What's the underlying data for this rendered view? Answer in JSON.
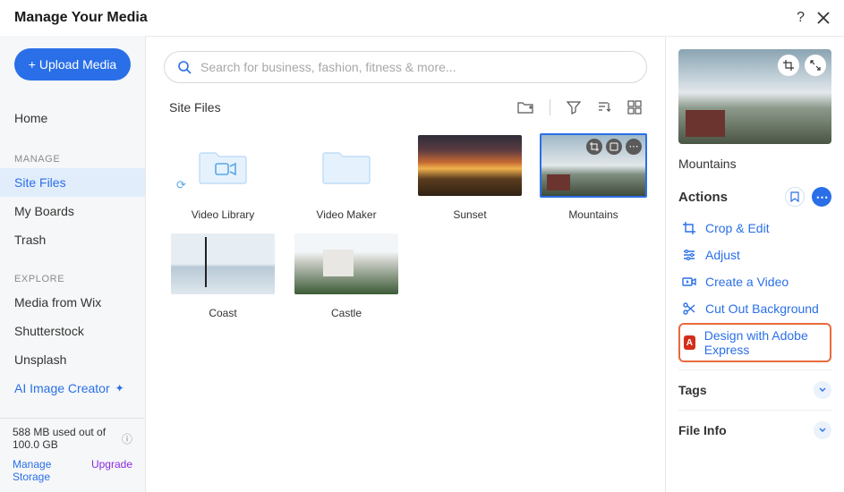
{
  "header": {
    "title": "Manage Your Media"
  },
  "sidebar": {
    "upload_label": "+ Upload Media",
    "home_label": "Home",
    "manage_label": "MANAGE",
    "manage_items": [
      "Site Files",
      "My Boards",
      "Trash"
    ],
    "explore_label": "EXPLORE",
    "explore_items": [
      "Media from Wix",
      "Shutterstock",
      "Unsplash",
      "AI Image Creator"
    ],
    "storage_text": "588 MB used out of 100.0 GB",
    "manage_storage": "Manage Storage",
    "upgrade_label": "Upgrade"
  },
  "search": {
    "placeholder": "Search for business, fashion, fitness & more..."
  },
  "toolbar": {
    "location": "Site Files"
  },
  "items": [
    {
      "label": "Video Library",
      "type": "folder"
    },
    {
      "label": "Video Maker",
      "type": "folder"
    },
    {
      "label": "Sunset",
      "type": "image"
    },
    {
      "label": "Mountains",
      "type": "image"
    },
    {
      "label": "Coast",
      "type": "image"
    },
    {
      "label": "Castle",
      "type": "image"
    }
  ],
  "details": {
    "file_name": "Mountains",
    "actions_title": "Actions",
    "actions": [
      "Crop & Edit",
      "Adjust",
      "Create a Video",
      "Cut Out Background",
      "Design with Adobe Express"
    ],
    "tags_title": "Tags",
    "fileinfo_title": "File Info"
  }
}
